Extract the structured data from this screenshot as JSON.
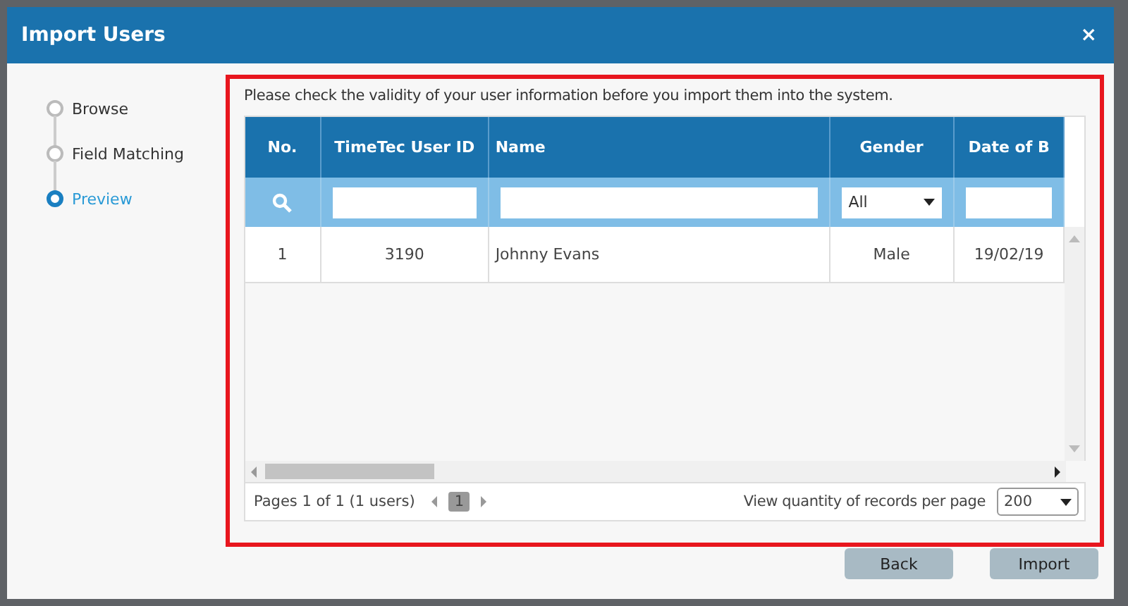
{
  "window": {
    "title": "Import Users",
    "close": "×"
  },
  "steps": [
    {
      "label": "Browse",
      "selected": false
    },
    {
      "label": "Field Matching",
      "selected": false
    },
    {
      "label": "Preview",
      "selected": true
    }
  ],
  "intro": "Please check the validity of your user information before you import them into the system.",
  "table": {
    "columns": [
      "No.",
      "TimeTec User ID",
      "Name",
      "Gender",
      "Date of B"
    ],
    "filters": [
      {
        "kind": "search"
      },
      {
        "kind": "text"
      },
      {
        "kind": "text"
      },
      {
        "kind": "select",
        "value": "All"
      },
      {
        "kind": "text"
      }
    ],
    "rows": [
      [
        "1",
        "3190",
        "Johnny Evans",
        "Male",
        "19/02/19"
      ]
    ]
  },
  "pagination": {
    "summary": "Pages 1 of 1 (1 users)",
    "pages": [
      {
        "label": "1",
        "selected": true
      }
    ],
    "per_page_label": "View quantity of records per page",
    "per_page": "200"
  },
  "buttons": [
    "Back",
    "Import"
  ]
}
